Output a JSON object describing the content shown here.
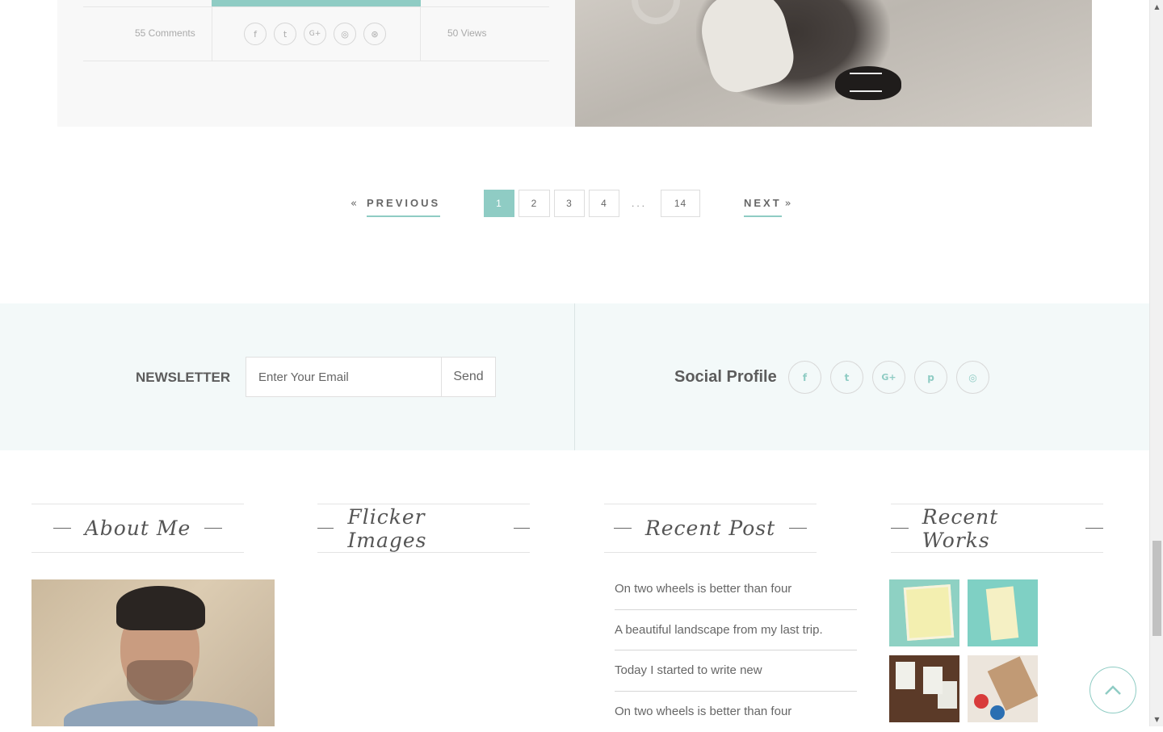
{
  "post_meta": {
    "comments": "55 Comments",
    "views": "50 Views",
    "share_icons": [
      "facebook-icon",
      "twitter-icon",
      "google-plus-icon",
      "instagram-icon",
      "dribbble-icon"
    ]
  },
  "pagination": {
    "prev_label": "PREVIOUS",
    "next_label": "NEXT",
    "prev_arrow": "«",
    "next_arrow": "»",
    "pages": [
      "1",
      "2",
      "3",
      "4"
    ],
    "ellipsis": "...",
    "last_page": "14",
    "active_page": "1"
  },
  "newsletter": {
    "label": "NEWSLETTER",
    "email_placeholder": "Enter Your Email",
    "send_label": "Send"
  },
  "social": {
    "label": "Social Profile",
    "icons": [
      {
        "name": "facebook-icon",
        "glyph": "f"
      },
      {
        "name": "twitter-icon",
        "glyph": "t"
      },
      {
        "name": "google-plus-icon",
        "glyph": "G+"
      },
      {
        "name": "pinterest-icon",
        "glyph": "p"
      },
      {
        "name": "instagram-icon",
        "glyph": "◎"
      }
    ]
  },
  "widgets": {
    "about_title": "About Me",
    "flicker_title": "Flicker Images",
    "recent_post_title": "Recent Post",
    "recent_works_title": "Recent Works"
  },
  "recent_posts": [
    "On two wheels is better than four",
    "A beautiful landscape from my last trip.",
    "Today I started to write new",
    "On two wheels is better than four"
  ],
  "colors": {
    "accent": "#8fccc4",
    "band_bg": "#f3f9f9",
    "post_bg": "#f8f8f8"
  }
}
